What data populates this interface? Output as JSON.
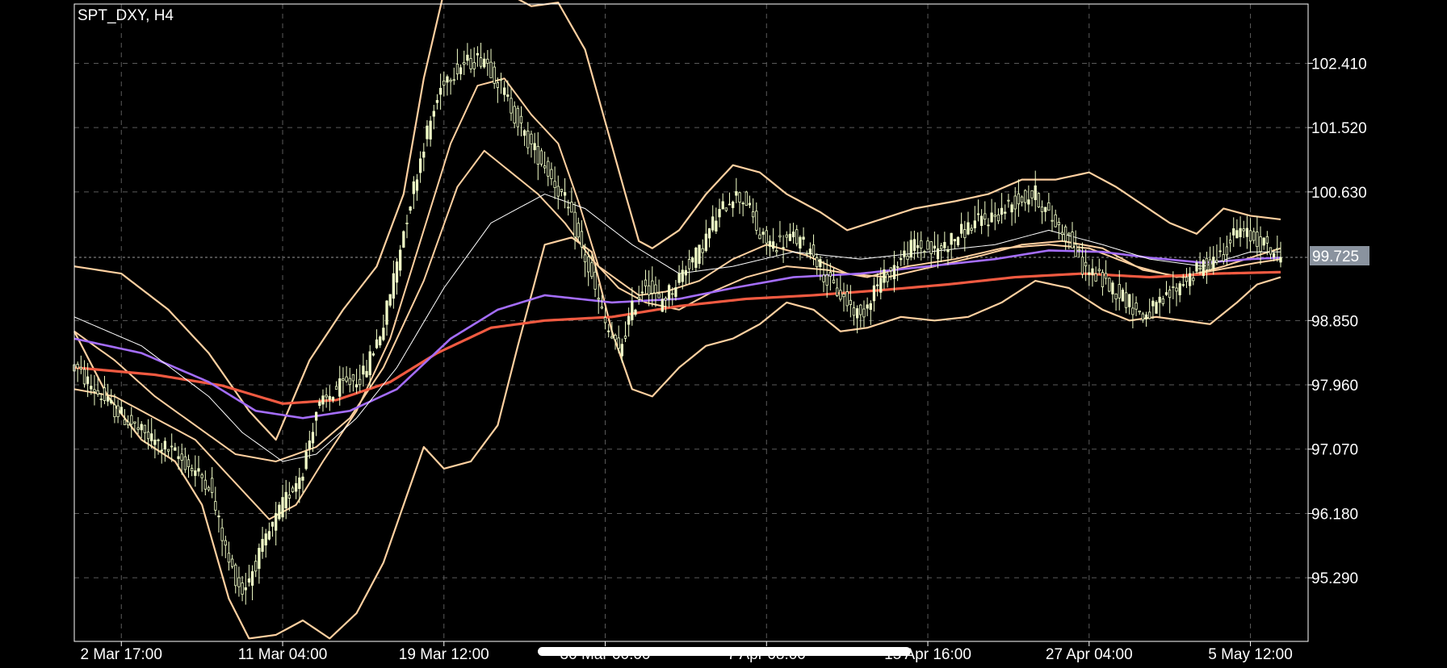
{
  "chart_data": {
    "type": "candlestick",
    "title": "SPT_DXY, H4",
    "current_price": "99.725",
    "grid": true,
    "ylim": [
      94.41,
      103.23
    ],
    "y_ticks": [
      "102.410",
      "101.520",
      "100.630",
      "98.850",
      "97.960",
      "97.070",
      "96.180",
      "95.290"
    ],
    "x_ticks": [
      {
        "label": "2 Mar 17:00",
        "bar": 14
      },
      {
        "label": "11 Mar 04:00",
        "bar": 62
      },
      {
        "label": "19 Mar 12:00",
        "bar": 110
      },
      {
        "label": "30 Mar 00:00",
        "bar": 158
      },
      {
        "label": "7 Apr 08:00",
        "bar": 206
      },
      {
        "label": "15 Apr 16:00",
        "bar": 254
      },
      {
        "label": "27 Apr 04:00",
        "bar": 302
      },
      {
        "label": "5 May 12:00",
        "bar": 350
      }
    ],
    "n_bars": 360,
    "colors": {
      "background": "#000000",
      "frame": "#ffffff",
      "grid": "#5a5a5a",
      "candle_up": "#f2ffc8",
      "candle_down": "#f2ffc8",
      "bollinger": "#ffd0a0",
      "ma_fast": "#ffffff",
      "ma_mid": "#a46dfb",
      "ma_slow": "#f05a41",
      "price_tag": "#8a939f"
    },
    "price_path": [
      [
        0,
        98.2
      ],
      [
        10,
        97.7
      ],
      [
        20,
        97.3
      ],
      [
        30,
        97.0
      ],
      [
        40,
        96.6
      ],
      [
        46,
        95.5
      ],
      [
        50,
        95.1
      ],
      [
        56,
        95.7
      ],
      [
        62,
        96.3
      ],
      [
        68,
        96.8
      ],
      [
        72,
        97.6
      ],
      [
        78,
        97.9
      ],
      [
        86,
        98.1
      ],
      [
        92,
        98.8
      ],
      [
        98,
        100.1
      ],
      [
        104,
        101.3
      ],
      [
        110,
        102.2
      ],
      [
        116,
        102.4
      ],
      [
        122,
        102.5
      ],
      [
        128,
        102.0
      ],
      [
        134,
        101.4
      ],
      [
        140,
        101.0
      ],
      [
        146,
        100.5
      ],
      [
        152,
        99.7
      ],
      [
        158,
        98.8
      ],
      [
        162,
        98.4
      ],
      [
        166,
        99.0
      ],
      [
        170,
        99.4
      ],
      [
        174,
        99.1
      ],
      [
        178,
        99.3
      ],
      [
        182,
        99.6
      ],
      [
        186,
        99.8
      ],
      [
        190,
        100.2
      ],
      [
        196,
        100.6
      ],
      [
        200,
        100.5
      ],
      [
        204,
        100.0
      ],
      [
        208,
        99.9
      ],
      [
        214,
        100.0
      ],
      [
        220,
        99.8
      ],
      [
        224,
        99.4
      ],
      [
        230,
        99.1
      ],
      [
        234,
        98.9
      ],
      [
        238,
        99.3
      ],
      [
        244,
        99.6
      ],
      [
        250,
        99.9
      ],
      [
        256,
        99.8
      ],
      [
        262,
        100.0
      ],
      [
        268,
        100.2
      ],
      [
        274,
        100.3
      ],
      [
        280,
        100.5
      ],
      [
        286,
        100.6
      ],
      [
        290,
        100.3
      ],
      [
        296,
        100.0
      ],
      [
        300,
        99.6
      ],
      [
        306,
        99.4
      ],
      [
        312,
        99.2
      ],
      [
        318,
        98.9
      ],
      [
        324,
        99.1
      ],
      [
        330,
        99.4
      ],
      [
        336,
        99.6
      ],
      [
        342,
        99.8
      ],
      [
        346,
        100.1
      ],
      [
        350,
        100.0
      ],
      [
        354,
        99.9
      ],
      [
        359,
        99.72
      ]
    ],
    "ma_fast_path": [
      [
        0,
        98.9
      ],
      [
        20,
        98.5
      ],
      [
        40,
        97.8
      ],
      [
        50,
        97.3
      ],
      [
        62,
        96.9
      ],
      [
        72,
        97.0
      ],
      [
        84,
        97.5
      ],
      [
        96,
        98.2
      ],
      [
        110,
        99.3
      ],
      [
        124,
        100.2
      ],
      [
        140,
        100.6
      ],
      [
        152,
        100.4
      ],
      [
        166,
        99.9
      ],
      [
        180,
        99.5
      ],
      [
        196,
        99.6
      ],
      [
        214,
        99.8
      ],
      [
        234,
        99.7
      ],
      [
        254,
        99.8
      ],
      [
        274,
        99.9
      ],
      [
        290,
        100.1
      ],
      [
        306,
        99.9
      ],
      [
        320,
        99.7
      ],
      [
        336,
        99.6
      ],
      [
        350,
        99.8
      ],
      [
        359,
        99.8
      ]
    ],
    "ma_mid_path": [
      [
        0,
        98.6
      ],
      [
        20,
        98.4
      ],
      [
        40,
        98.0
      ],
      [
        54,
        97.6
      ],
      [
        68,
        97.5
      ],
      [
        82,
        97.6
      ],
      [
        96,
        97.9
      ],
      [
        112,
        98.6
      ],
      [
        126,
        99.0
      ],
      [
        140,
        99.2
      ],
      [
        160,
        99.1
      ],
      [
        180,
        99.15
      ],
      [
        196,
        99.3
      ],
      [
        214,
        99.45
      ],
      [
        234,
        99.5
      ],
      [
        254,
        99.6
      ],
      [
        274,
        99.7
      ],
      [
        290,
        99.82
      ],
      [
        306,
        99.8
      ],
      [
        320,
        99.72
      ],
      [
        336,
        99.65
      ],
      [
        350,
        99.7
      ],
      [
        359,
        99.72
      ]
    ],
    "ma_slow_path": [
      [
        0,
        98.2
      ],
      [
        24,
        98.1
      ],
      [
        44,
        97.95
      ],
      [
        62,
        97.7
      ],
      [
        78,
        97.75
      ],
      [
        94,
        98.0
      ],
      [
        108,
        98.4
      ],
      [
        124,
        98.75
      ],
      [
        140,
        98.85
      ],
      [
        160,
        98.9
      ],
      [
        180,
        99.05
      ],
      [
        200,
        99.15
      ],
      [
        220,
        99.2
      ],
      [
        240,
        99.27
      ],
      [
        260,
        99.35
      ],
      [
        280,
        99.45
      ],
      [
        300,
        99.5
      ],
      [
        320,
        99.45
      ],
      [
        340,
        99.5
      ],
      [
        359,
        99.52
      ]
    ],
    "bb_upper_path": [
      [
        0,
        99.6
      ],
      [
        14,
        99.5
      ],
      [
        28,
        99.0
      ],
      [
        40,
        98.4
      ],
      [
        52,
        97.6
      ],
      [
        60,
        97.2
      ],
      [
        70,
        98.3
      ],
      [
        80,
        99.0
      ],
      [
        90,
        99.6
      ],
      [
        98,
        100.6
      ],
      [
        104,
        102.2
      ],
      [
        110,
        103.4
      ],
      [
        120,
        103.6
      ],
      [
        128,
        103.4
      ],
      [
        136,
        103.2
      ],
      [
        144,
        103.25
      ],
      [
        152,
        102.6
      ],
      [
        158,
        101.6
      ],
      [
        164,
        100.6
      ],
      [
        168,
        99.95
      ],
      [
        172,
        99.85
      ],
      [
        180,
        100.1
      ],
      [
        188,
        100.6
      ],
      [
        196,
        101.0
      ],
      [
        204,
        100.9
      ],
      [
        212,
        100.6
      ],
      [
        222,
        100.35
      ],
      [
        230,
        100.1
      ],
      [
        240,
        100.25
      ],
      [
        250,
        100.4
      ],
      [
        262,
        100.5
      ],
      [
        272,
        100.6
      ],
      [
        282,
        100.8
      ],
      [
        292,
        100.8
      ],
      [
        302,
        100.9
      ],
      [
        310,
        100.7
      ],
      [
        318,
        100.45
      ],
      [
        326,
        100.2
      ],
      [
        334,
        100.05
      ],
      [
        342,
        100.4
      ],
      [
        350,
        100.3
      ],
      [
        359,
        100.25
      ]
    ],
    "bb_lower_path": [
      [
        0,
        98.7
      ],
      [
        10,
        97.8
      ],
      [
        20,
        97.2
      ],
      [
        30,
        96.9
      ],
      [
        38,
        96.3
      ],
      [
        46,
        95.0
      ],
      [
        52,
        94.45
      ],
      [
        60,
        94.5
      ],
      [
        68,
        94.7
      ],
      [
        76,
        94.45
      ],
      [
        84,
        94.8
      ],
      [
        92,
        95.5
      ],
      [
        98,
        96.3
      ],
      [
        104,
        97.1
      ],
      [
        110,
        96.8
      ],
      [
        118,
        96.9
      ],
      [
        126,
        97.4
      ],
      [
        132,
        98.5
      ],
      [
        140,
        99.9
      ],
      [
        148,
        100.0
      ],
      [
        154,
        99.8
      ],
      [
        160,
        98.7
      ],
      [
        166,
        97.9
      ],
      [
        172,
        97.8
      ],
      [
        180,
        98.2
      ],
      [
        188,
        98.5
      ],
      [
        196,
        98.6
      ],
      [
        204,
        98.8
      ],
      [
        212,
        99.1
      ],
      [
        220,
        99.0
      ],
      [
        228,
        98.7
      ],
      [
        236,
        98.75
      ],
      [
        246,
        98.9
      ],
      [
        256,
        98.85
      ],
      [
        266,
        98.9
      ],
      [
        276,
        99.1
      ],
      [
        286,
        99.4
      ],
      [
        296,
        99.3
      ],
      [
        306,
        99.0
      ],
      [
        314,
        98.85
      ],
      [
        322,
        98.9
      ],
      [
        330,
        98.85
      ],
      [
        338,
        98.8
      ],
      [
        346,
        99.1
      ],
      [
        352,
        99.35
      ],
      [
        359,
        99.45
      ]
    ],
    "bb_outer_upper_path": [
      [
        0,
        97.9
      ],
      [
        12,
        97.8
      ],
      [
        24,
        97.5
      ],
      [
        36,
        97.2
      ],
      [
        48,
        96.6
      ],
      [
        58,
        96.1
      ],
      [
        66,
        96.3
      ],
      [
        74,
        96.9
      ],
      [
        84,
        97.6
      ],
      [
        94,
        98.6
      ],
      [
        102,
        99.8
      ],
      [
        112,
        101.3
      ],
      [
        120,
        102.1
      ],
      [
        128,
        102.2
      ],
      [
        136,
        101.7
      ],
      [
        144,
        101.3
      ],
      [
        150,
        100.5
      ],
      [
        156,
        99.6
      ],
      [
        162,
        99.4
      ],
      [
        168,
        99.2
      ],
      [
        176,
        99.25
      ],
      [
        186,
        99.4
      ],
      [
        196,
        99.7
      ],
      [
        206,
        99.9
      ],
      [
        218,
        99.75
      ],
      [
        230,
        99.5
      ],
      [
        242,
        99.45
      ],
      [
        256,
        99.6
      ],
      [
        270,
        99.75
      ],
      [
        282,
        99.9
      ],
      [
        294,
        99.95
      ],
      [
        306,
        99.85
      ],
      [
        318,
        99.55
      ],
      [
        330,
        99.45
      ],
      [
        342,
        99.6
      ],
      [
        352,
        99.75
      ],
      [
        359,
        99.85
      ]
    ],
    "bb_outer_lower_path": [
      [
        0,
        98.7
      ],
      [
        12,
        98.3
      ],
      [
        24,
        97.8
      ],
      [
        36,
        97.4
      ],
      [
        48,
        97.0
      ],
      [
        60,
        96.9
      ],
      [
        72,
        97.1
      ],
      [
        82,
        97.5
      ],
      [
        92,
        98.2
      ],
      [
        104,
        99.4
      ],
      [
        114,
        100.7
      ],
      [
        122,
        101.2
      ],
      [
        130,
        100.9
      ],
      [
        138,
        100.6
      ],
      [
        146,
        100.2
      ],
      [
        154,
        99.7
      ],
      [
        162,
        99.3
      ],
      [
        170,
        99.1
      ],
      [
        180,
        99.0
      ],
      [
        190,
        99.25
      ],
      [
        200,
        99.45
      ],
      [
        212,
        99.6
      ],
      [
        224,
        99.55
      ],
      [
        236,
        99.45
      ],
      [
        248,
        99.6
      ],
      [
        262,
        99.7
      ],
      [
        276,
        99.85
      ],
      [
        290,
        99.9
      ],
      [
        302,
        99.85
      ],
      [
        316,
        99.6
      ],
      [
        328,
        99.45
      ],
      [
        340,
        99.55
      ],
      [
        352,
        99.65
      ],
      [
        359,
        99.7
      ]
    ]
  }
}
